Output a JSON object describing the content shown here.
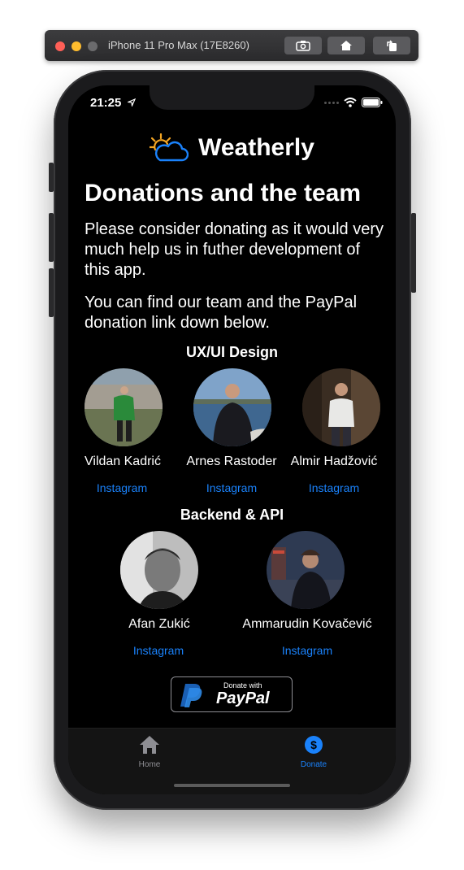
{
  "simulator": {
    "title": "iPhone 11 Pro Max (17E8260)",
    "buttons": [
      "screenshot-icon",
      "home-icon",
      "rotate-icon"
    ]
  },
  "status_bar": {
    "time": "21:25"
  },
  "app": {
    "name": "Weatherly",
    "logo": "sun-cloud-icon"
  },
  "page": {
    "title": "Donations and the team",
    "intro": "Please consider donating as it would very much help us in futher development of this app.",
    "note": "You can find our team and the PayPal donation link down below."
  },
  "sections": [
    {
      "title": "UX/UI Design",
      "members": [
        {
          "name": "Vildan Kadrić",
          "link": "Instagram"
        },
        {
          "name": "Arnes Rastoder",
          "link": "Instagram"
        },
        {
          "name": "Almir Hadžović",
          "link": "Instagram"
        }
      ]
    },
    {
      "title": "Backend & API",
      "members": [
        {
          "name": "Afan Zukić",
          "link": "Instagram"
        },
        {
          "name": "Ammarudin Kovačević",
          "link": "Instagram"
        }
      ]
    }
  ],
  "paypal": {
    "small": "Donate with",
    "big": "PayPal"
  },
  "tabs": [
    {
      "label": "Home",
      "icon": "house-icon",
      "active": false
    },
    {
      "label": "Donate",
      "icon": "dollar-circle-icon",
      "active": true
    }
  ],
  "colors": {
    "accent": "#1a82fb",
    "background": "#000000",
    "inactive_tab": "#8e8e93"
  }
}
